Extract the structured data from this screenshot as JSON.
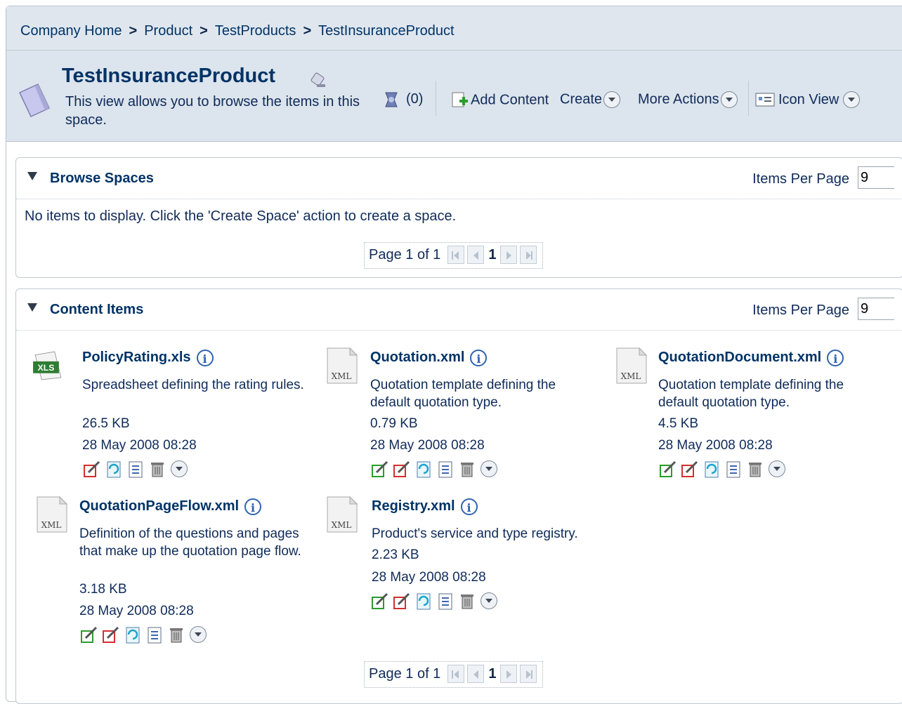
{
  "breadcrumb": [
    "Company Home",
    "Product",
    "TestProducts",
    "TestInsuranceProduct"
  ],
  "breadcrumb_separator": ">",
  "header": {
    "title": "TestInsuranceProduct",
    "description": "This view allows you to browse the items in this space.",
    "rules_count": "(0)",
    "add_content": "Add Content",
    "create": "Create",
    "more_actions": "More Actions",
    "view_mode": "Icon View"
  },
  "browse_spaces": {
    "title": "Browse Spaces",
    "items_per_page_label": "Items Per Page",
    "items_per_page": "9",
    "empty_message": "No items to display. Click the 'Create Space' action to create a space.",
    "pager": {
      "text": "Page 1 of 1",
      "current": "1"
    }
  },
  "content_items": {
    "title": "Content Items",
    "items_per_page_label": "Items Per Page",
    "items_per_page": "9",
    "pager": {
      "text": "Page 1 of 1",
      "current": "1"
    },
    "items": [
      {
        "name": "PolicyRating.xls",
        "icon": "xls-file-icon",
        "icon_label": "XLS",
        "description": "Spreadsheet defining the rating rules.",
        "size": "26.5 KB",
        "date": "28 May 2008 08:28"
      },
      {
        "name": "Quotation.xml",
        "icon": "xml-file-icon",
        "icon_label": "XML",
        "description": "Quotation template defining the default quotation type.",
        "size": "0.79 KB",
        "date": "28 May 2008 08:28"
      },
      {
        "name": "QuotationDocument.xml",
        "icon": "xml-file-icon",
        "icon_label": "XML",
        "description": "Quotation template defining the default quotation type.",
        "size": "4.5 KB",
        "date": "28 May 2008 08:28"
      },
      {
        "name": "QuotationPageFlow.xml",
        "icon": "xml-file-icon",
        "icon_label": "XML",
        "description": "Definition of the questions and pages that make up the quotation page flow.",
        "size": "3.18 KB",
        "date": "28 May 2008 08:28"
      },
      {
        "name": "Registry.xml",
        "icon": "xml-file-icon",
        "icon_label": "XML",
        "description": "Product's service and type registry.",
        "size": "2.23 KB",
        "date": "28 May 2008 08:28"
      }
    ]
  },
  "colors": {
    "link": "#003366",
    "header_bg": "#dce4ed",
    "breadcrumb_bg": "#dfe6ee",
    "xls_green": "#2e7d32"
  }
}
